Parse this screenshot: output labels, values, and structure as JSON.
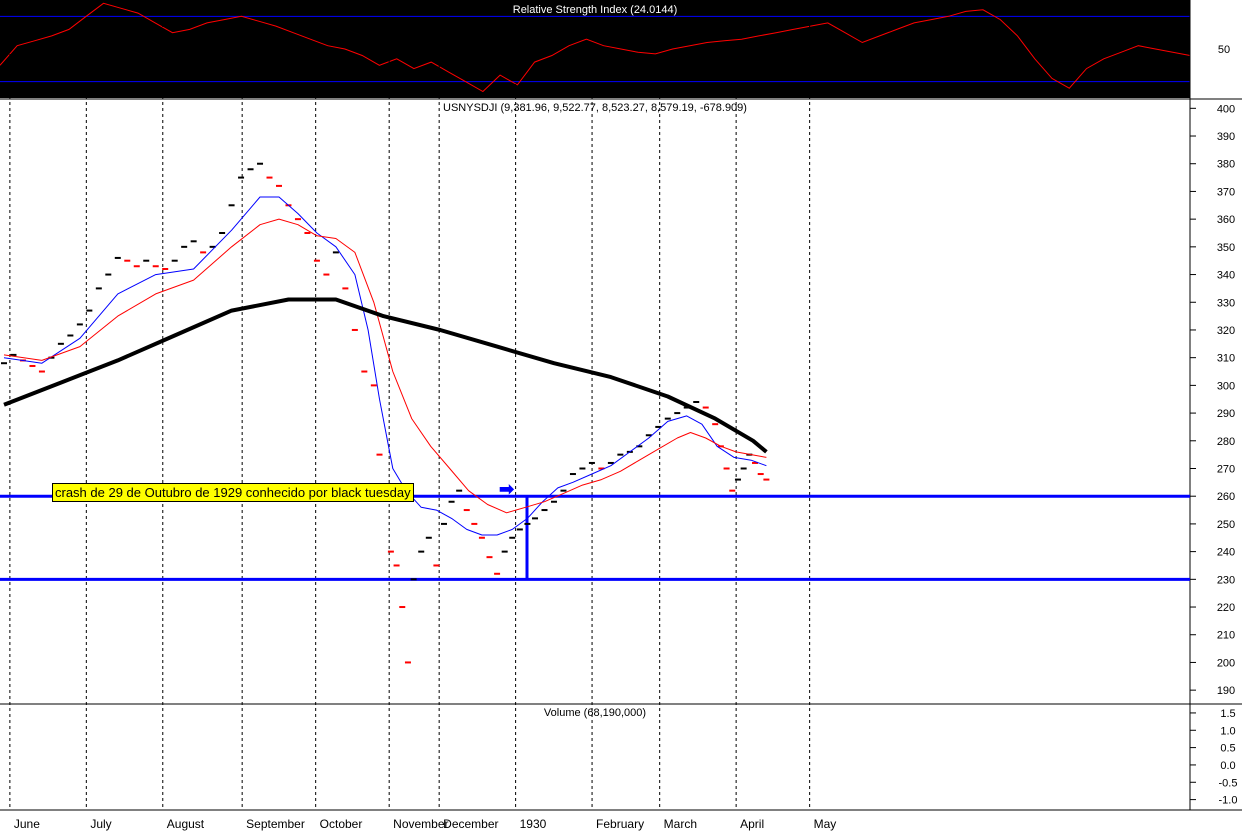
{
  "chart_data": [
    {
      "type": "line",
      "title": "Relative Strength Index (24.0144)",
      "ylabel_ticks": [
        "50"
      ],
      "ylim": [
        20,
        80
      ],
      "reference_lines": [
        70,
        30
      ],
      "colors": {
        "background": "#000000",
        "line": "#ff0000",
        "reference": "#0000ff"
      },
      "series": [
        {
          "values": [
            40,
            52,
            55,
            58,
            62,
            70,
            78,
            75,
            72,
            66,
            60,
            62,
            66,
            68,
            70,
            67,
            64,
            60,
            56,
            52,
            50,
            46,
            40,
            44,
            38,
            42,
            36,
            30,
            24,
            34,
            28,
            42,
            46,
            52,
            56,
            52,
            50,
            48,
            47,
            50,
            52,
            54,
            55,
            56,
            58,
            60,
            62,
            64,
            66,
            60,
            54,
            58,
            62,
            66,
            68,
            70,
            73,
            74,
            68,
            58,
            44,
            32,
            26,
            38,
            44,
            48,
            52,
            50,
            48,
            46
          ]
        }
      ]
    },
    {
      "type": "line",
      "title": "USNYSDJI (9,381.96, 9,522.77, 8,523.27, 8,579.19, -678.909)",
      "x_labels": [
        "June",
        "July",
        "August",
        "September",
        "October",
        "November",
        "December",
        "1930",
        "February",
        "March",
        "April",
        "May"
      ],
      "yticks": [
        190,
        200,
        210,
        220,
        230,
        240,
        250,
        260,
        270,
        280,
        290,
        300,
        310,
        320,
        330,
        340,
        350,
        360,
        370,
        380,
        390,
        400
      ],
      "ylim": [
        185,
        403
      ],
      "horizontal_lines": [
        260,
        230
      ],
      "annotation": "crash de 29 de Outubro de 1929 conhecido por black tuesday",
      "colors": {
        "price_bars_up": "#000000",
        "price_bars_down": "#ff0000",
        "ma_short": "#0000ff",
        "ma_medium": "#ff0000",
        "ma_long": "#000000",
        "levels": "#0000ff"
      },
      "price_series": [
        [
          0,
          308
        ],
        [
          5,
          311
        ],
        [
          10,
          309
        ],
        [
          15,
          307
        ],
        [
          20,
          305
        ],
        [
          25,
          310
        ],
        [
          30,
          315
        ],
        [
          35,
          318
        ],
        [
          40,
          322
        ],
        [
          45,
          327
        ],
        [
          50,
          335
        ],
        [
          55,
          340
        ],
        [
          60,
          346
        ],
        [
          65,
          345
        ],
        [
          70,
          343
        ],
        [
          75,
          345
        ],
        [
          80,
          343
        ],
        [
          85,
          342
        ],
        [
          90,
          345
        ],
        [
          95,
          350
        ],
        [
          100,
          352
        ],
        [
          105,
          348
        ],
        [
          110,
          350
        ],
        [
          115,
          355
        ],
        [
          120,
          365
        ],
        [
          125,
          375
        ],
        [
          130,
          378
        ],
        [
          135,
          380
        ],
        [
          140,
          375
        ],
        [
          145,
          372
        ],
        [
          150,
          365
        ],
        [
          155,
          360
        ],
        [
          160,
          355
        ],
        [
          165,
          345
        ],
        [
          170,
          340
        ],
        [
          175,
          348
        ],
        [
          180,
          335
        ],
        [
          185,
          320
        ],
        [
          190,
          305
        ],
        [
          195,
          300
        ],
        [
          198,
          275
        ],
        [
          201,
          260
        ],
        [
          204,
          240
        ],
        [
          207,
          235
        ],
        [
          210,
          220
        ],
        [
          213,
          200
        ],
        [
          216,
          230
        ],
        [
          220,
          240
        ],
        [
          224,
          245
        ],
        [
          228,
          235
        ],
        [
          232,
          250
        ],
        [
          236,
          258
        ],
        [
          240,
          262
        ],
        [
          244,
          255
        ],
        [
          248,
          250
        ],
        [
          252,
          245
        ],
        [
          256,
          238
        ],
        [
          260,
          232
        ],
        [
          264,
          240
        ],
        [
          268,
          245
        ],
        [
          272,
          248
        ],
        [
          276,
          250
        ],
        [
          280,
          252
        ],
        [
          285,
          255
        ],
        [
          290,
          258
        ],
        [
          295,
          262
        ],
        [
          300,
          268
        ],
        [
          305,
          270
        ],
        [
          310,
          272
        ],
        [
          315,
          270
        ],
        [
          320,
          272
        ],
        [
          325,
          275
        ],
        [
          330,
          276
        ],
        [
          335,
          278
        ],
        [
          340,
          282
        ],
        [
          345,
          285
        ],
        [
          350,
          288
        ],
        [
          355,
          290
        ],
        [
          360,
          292
        ],
        [
          365,
          294
        ],
        [
          370,
          292
        ],
        [
          375,
          286
        ],
        [
          378,
          278
        ],
        [
          381,
          270
        ],
        [
          384,
          262
        ],
        [
          387,
          266
        ],
        [
          390,
          270
        ],
        [
          393,
          275
        ],
        [
          396,
          272
        ],
        [
          399,
          268
        ],
        [
          402,
          266
        ]
      ],
      "series": [
        {
          "values": [
            [
              0,
              310
            ],
            [
              20,
              308
            ],
            [
              40,
              317
            ],
            [
              60,
              333
            ],
            [
              80,
              340
            ],
            [
              100,
              342
            ],
            [
              120,
              356
            ],
            [
              135,
              368
            ],
            [
              145,
              368
            ],
            [
              155,
              362
            ],
            [
              165,
              355
            ],
            [
              175,
              350
            ],
            [
              185,
              340
            ],
            [
              192,
              320
            ],
            [
              198,
              295
            ],
            [
              205,
              270
            ],
            [
              212,
              262
            ],
            [
              220,
              256
            ],
            [
              228,
              255
            ],
            [
              236,
              252
            ],
            [
              244,
              248
            ],
            [
              252,
              246
            ],
            [
              260,
              246
            ],
            [
              268,
              248
            ],
            [
              276,
              252
            ],
            [
              284,
              258
            ],
            [
              292,
              263
            ],
            [
              300,
              265
            ],
            [
              310,
              268
            ],
            [
              320,
              271
            ],
            [
              330,
              276
            ],
            [
              340,
              281
            ],
            [
              350,
              287
            ],
            [
              360,
              289
            ],
            [
              368,
              286
            ],
            [
              376,
              278
            ],
            [
              385,
              274
            ],
            [
              394,
              273
            ],
            [
              402,
              271
            ]
          ]
        },
        {
          "values": [
            [
              0,
              311
            ],
            [
              20,
              309
            ],
            [
              40,
              314
            ],
            [
              60,
              325
            ],
            [
              80,
              333
            ],
            [
              100,
              338
            ],
            [
              120,
              350
            ],
            [
              135,
              358
            ],
            [
              145,
              360
            ],
            [
              155,
              358
            ],
            [
              165,
              354
            ],
            [
              175,
              353
            ],
            [
              185,
              348
            ],
            [
              195,
              330
            ],
            [
              205,
              305
            ],
            [
              215,
              288
            ],
            [
              225,
              278
            ],
            [
              235,
              270
            ],
            [
              245,
              262
            ],
            [
              255,
              257
            ],
            [
              265,
              254
            ],
            [
              275,
              256
            ],
            [
              285,
              258
            ],
            [
              295,
              261
            ],
            [
              305,
              264
            ],
            [
              315,
              266
            ],
            [
              325,
              269
            ],
            [
              335,
              273
            ],
            [
              345,
              277
            ],
            [
              355,
              281
            ],
            [
              362,
              283
            ],
            [
              370,
              281
            ],
            [
              378,
              278
            ],
            [
              386,
              276
            ],
            [
              394,
              275
            ],
            [
              402,
              274
            ]
          ]
        },
        {
          "values": [
            [
              0,
              293
            ],
            [
              30,
              301
            ],
            [
              60,
              309
            ],
            [
              90,
              318
            ],
            [
              120,
              327
            ],
            [
              150,
              331
            ],
            [
              175,
              331
            ],
            [
              200,
              325
            ],
            [
              230,
              320
            ],
            [
              260,
              314
            ],
            [
              290,
              308
            ],
            [
              320,
              303
            ],
            [
              350,
              296
            ],
            [
              375,
              288
            ],
            [
              395,
              280
            ],
            [
              402,
              276
            ]
          ]
        }
      ]
    },
    {
      "type": "bar",
      "title": "Volume (68,190,000)",
      "yticks": [
        "1.5",
        "1.0",
        "0.5",
        "0.0",
        "-0.5",
        "-1.0"
      ],
      "ylim": [
        -1.3,
        1.7
      ]
    }
  ],
  "x_axis": {
    "labels": [
      "June",
      "July",
      "August",
      "September",
      "October",
      "November",
      "December",
      "1930",
      "February",
      "March",
      "April",
      "May"
    ]
  },
  "rsi_ytick": "50"
}
